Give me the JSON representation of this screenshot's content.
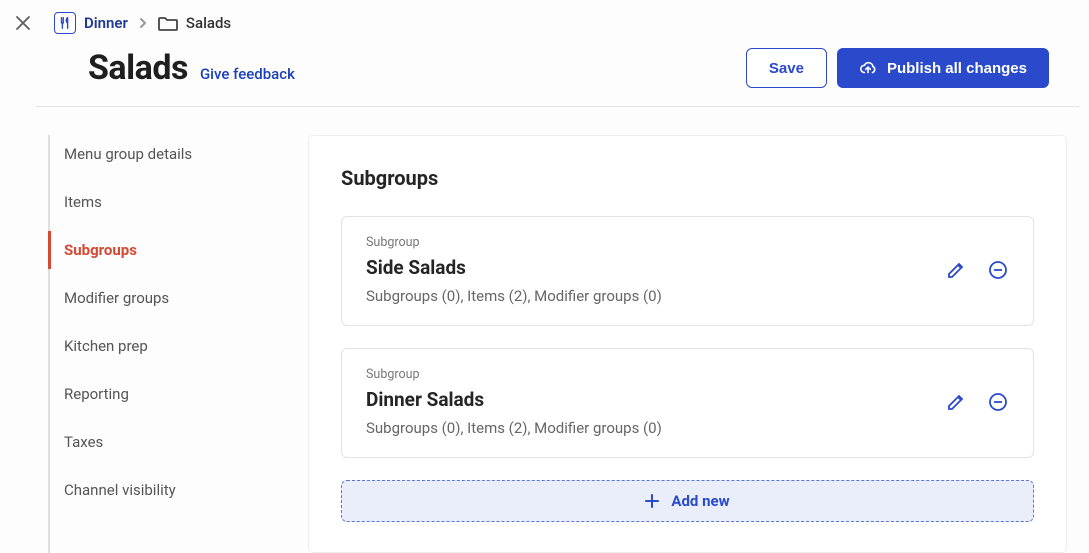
{
  "breadcrumb": {
    "parent": "Dinner",
    "current": "Salads"
  },
  "header": {
    "title": "Salads",
    "feedback": "Give feedback",
    "save": "Save",
    "publish": "Publish all changes"
  },
  "sidenav": {
    "items": [
      {
        "label": "Menu group details",
        "active": false
      },
      {
        "label": "Items",
        "active": false
      },
      {
        "label": "Subgroups",
        "active": true
      },
      {
        "label": "Modifier groups",
        "active": false
      },
      {
        "label": "Kitchen prep",
        "active": false
      },
      {
        "label": "Reporting",
        "active": false
      },
      {
        "label": "Taxes",
        "active": false
      },
      {
        "label": "Channel visibility",
        "active": false
      }
    ]
  },
  "panel": {
    "title": "Subgroups",
    "card_label": "Subgroup",
    "add_new": "Add new",
    "cards": [
      {
        "name": "Side Salads",
        "meta": "Subgroups (0), Items (2), Modifier groups (0)"
      },
      {
        "name": "Dinner Salads",
        "meta": "Subgroups (0), Items (2), Modifier groups (0)"
      }
    ]
  }
}
